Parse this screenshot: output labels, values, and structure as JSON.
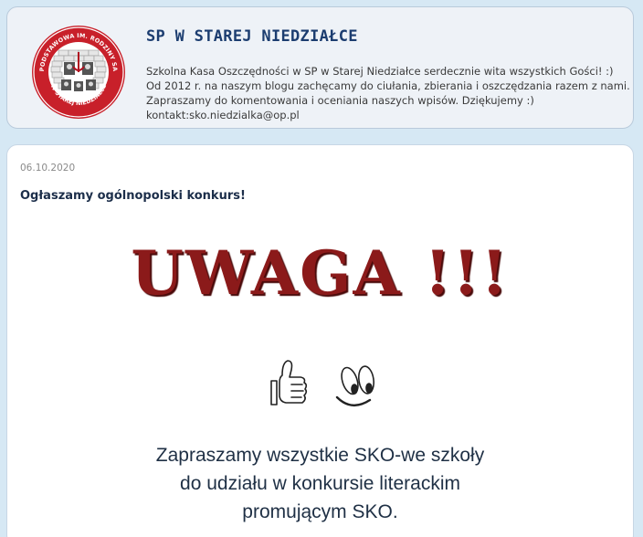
{
  "header": {
    "blog_title": "SP W STAREJ NIEDZIAŁCE",
    "description_lines": [
      "Szkolna Kasa Oszczędności w SP w Starej Niedziałce serdecznie wita wszystkich Gości! :)",
      "Od 2012 r. na naszym blogu zachęcamy do ciułania, zbierania i oszczędzania razem z nami.",
      "Zapraszamy do komentowania i oceniania naszych wpisów. Dziękujemy :)",
      "kontakt:sko.niedzialka@op.pl"
    ],
    "logo": {
      "ring_text_top": "SZKOŁA PODSTAWOWA IM. RODZINY SAJNÓGÓW",
      "ring_text_bottom": "W STAREJ NIEDZIAŁCE",
      "icon": "school-emblem-icon",
      "ring_color": "#c8202a"
    }
  },
  "post": {
    "date": "06.10.2020",
    "title": "Ogłaszamy ogólnopolski konkurs!",
    "headline": "UWAGA !!!",
    "headline_color": "#8b1a1a",
    "emojis": [
      "thumbs-up-icon",
      "smiley-eyes-icon"
    ],
    "invite_lines": [
      "Zapraszamy wszystkie SKO-we szkoły",
      "do udziału w konkursie literackim",
      "promującym SKO."
    ]
  }
}
